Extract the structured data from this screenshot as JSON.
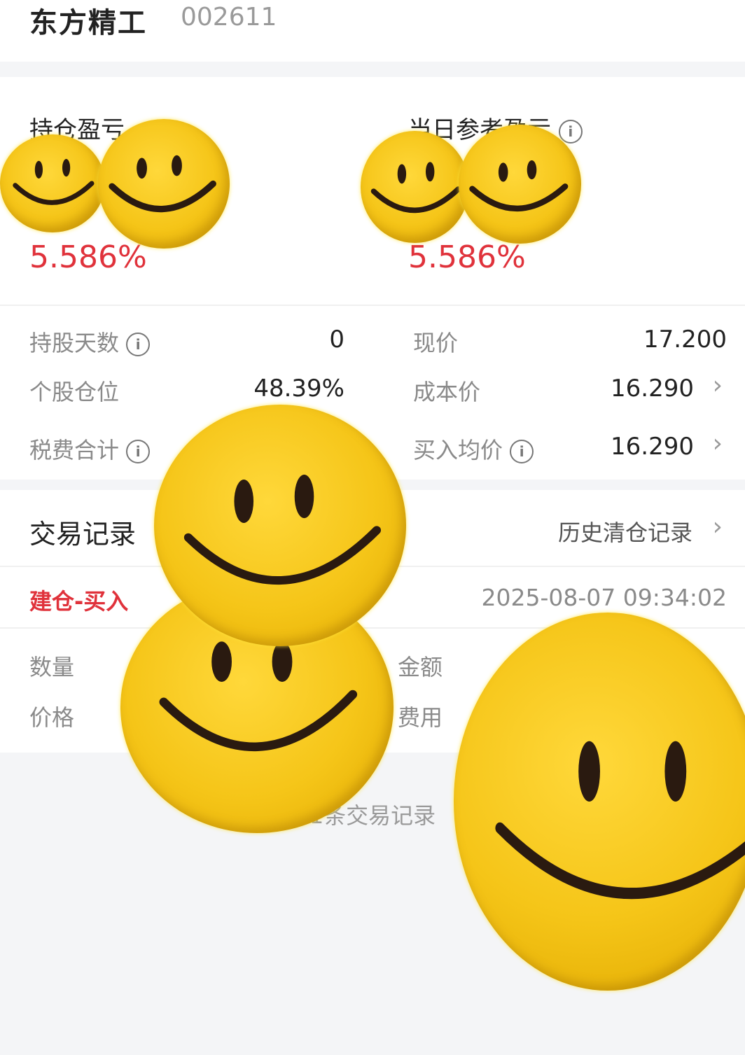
{
  "header": {
    "stock_name": "东方精工",
    "stock_code": "002611"
  },
  "profit": {
    "holding_label": "持仓盈亏",
    "holding_pct": "5.586%",
    "daily_label": "当日参考盈亏",
    "daily_pct": "5.586%"
  },
  "details": {
    "days_label": "持股天数",
    "days_value": "0",
    "position_label": "个股仓位",
    "position_value": "48.39%",
    "fee_label": "税费合计",
    "price_label": "现价",
    "price_value": "17.200",
    "cost_label": "成本价",
    "cost_value": "16.290",
    "avg_label": "买入均价",
    "avg_value": "16.290"
  },
  "trades": {
    "title": "交易记录",
    "history_link": "历史清仓记录",
    "record_type": "建仓-买入",
    "record_time": "2025-08-07 09:34:02",
    "qty_label": "数量",
    "amount_label": "金额",
    "price_label": "价格",
    "fee_label": "费用",
    "footer": "1条交易记录"
  },
  "icons": {
    "info": "info-circle-icon",
    "chevron": "chevron-right-icon",
    "sticker": "smiley-face-icon"
  },
  "colors": {
    "loss_red": "#e0323b",
    "sticker_yellow": "#f5c518"
  }
}
